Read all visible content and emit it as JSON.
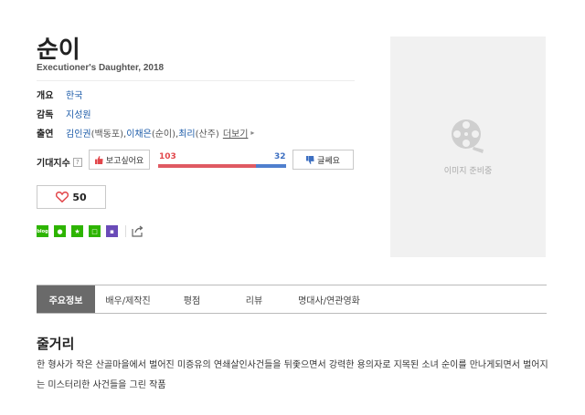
{
  "movie": {
    "title": "순이",
    "subtitle": "Executioner's Daughter, 2018"
  },
  "info": {
    "overview_label": "개요",
    "overview_value": "한국",
    "director_label": "감독",
    "director_value": "지성원",
    "cast_label": "출연",
    "cast": [
      {
        "name": "김인권",
        "role": "(백동포), "
      },
      {
        "name": "이채은",
        "role": "(순이), "
      },
      {
        "name": "최리",
        "role": "(산주)"
      }
    ],
    "more_label": "더보기"
  },
  "expectation": {
    "label": "기대지수",
    "help_icon": "question-icon",
    "want_label": "보고싶어요",
    "nowant_label": "글쎄요",
    "want_count": "103",
    "nowant_count": "32",
    "want_color": "#e05a63",
    "nowant_color": "#4f7fce",
    "want_fraction": 0.763
  },
  "like": {
    "count": "50"
  },
  "share_icons": [
    {
      "name": "blog-icon",
      "color": "#2db400",
      "glyph": "b"
    },
    {
      "name": "band-icon",
      "color": "#2db400",
      "glyph": "•"
    },
    {
      "name": "bookmark-star-icon",
      "color": "#2db400",
      "glyph": "★"
    },
    {
      "name": "memo-icon",
      "color": "#2db400",
      "glyph": "□"
    },
    {
      "name": "calendar-icon",
      "color": "#6a4bb8",
      "glyph": "▪"
    }
  ],
  "poster": {
    "placeholder": "이미지 준비중"
  },
  "tabs": [
    {
      "label": "주요정보",
      "active": true
    },
    {
      "label": "배우/제작진",
      "active": false
    },
    {
      "label": "평점",
      "active": false
    },
    {
      "label": "리뷰",
      "active": false
    },
    {
      "label": "명대사/연관영화",
      "active": false
    }
  ],
  "synopsis": {
    "title": "줄거리",
    "text": "한 형사가 작은 산골마을에서 벌어진 미증유의 연쇄살인사건들을 뒤좇으면서 강력한 용의자로 지목된 소녀 순이를 만나게되면서 벌어지는 미스터리한 사건들을 그린 작품"
  }
}
